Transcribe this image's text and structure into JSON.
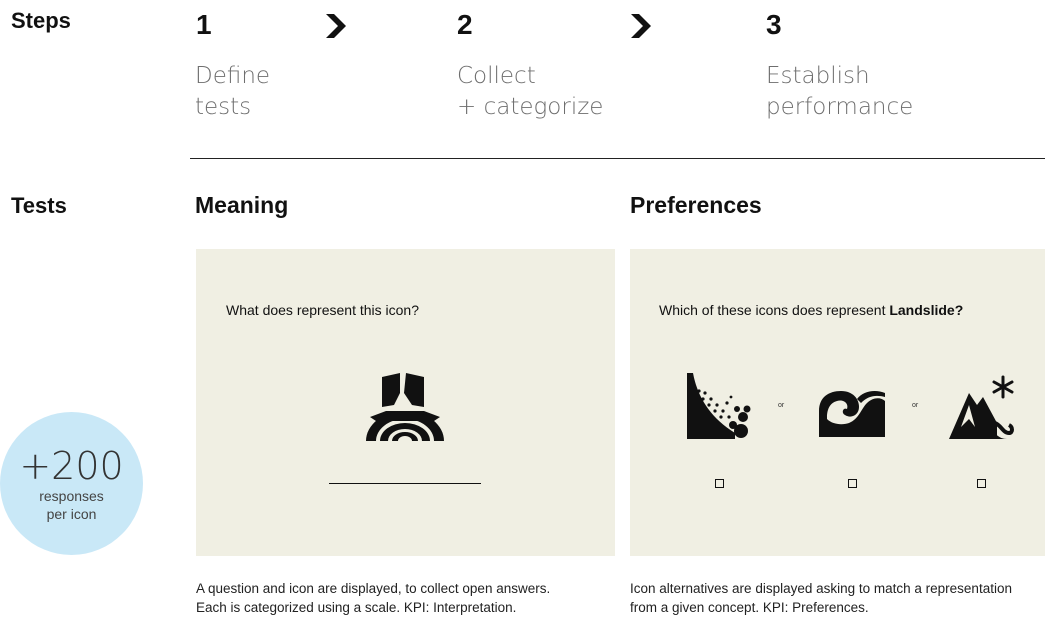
{
  "steps_label": "Steps",
  "steps": [
    {
      "number": "1",
      "line1": "Define",
      "line2": "tests"
    },
    {
      "number": "2",
      "line1": "Collect",
      "line2": "+ categorize"
    },
    {
      "number": "3",
      "line1": "Establish",
      "line2": "performance"
    }
  ],
  "tests_label": "Tests",
  "stat": {
    "value": "+200",
    "line1": "responses",
    "line2": "per icon"
  },
  "meaning": {
    "title": "Meaning",
    "question": "What does represent this icon?",
    "icon": "road-collapse-icon",
    "caption1": "A question and icon are displayed, to collect open answers.",
    "caption2": "Each is categorized using a scale. KPI: Interpretation."
  },
  "preferences": {
    "title": "Preferences",
    "question_prefix": "Which of these icons does represent ",
    "question_bold": "Landslide?",
    "icons": [
      "landslide-slope-icon",
      "wave-icon",
      "mountain-snow-icon"
    ],
    "or_label": "or",
    "caption1": "Icon alternatives are displayed asking to match a representation",
    "caption2": "from a given concept. KPI: Preferences."
  },
  "colors": {
    "card": "#f0efe3",
    "stat_circle": "#c9e8f7",
    "ink": "#111111"
  }
}
